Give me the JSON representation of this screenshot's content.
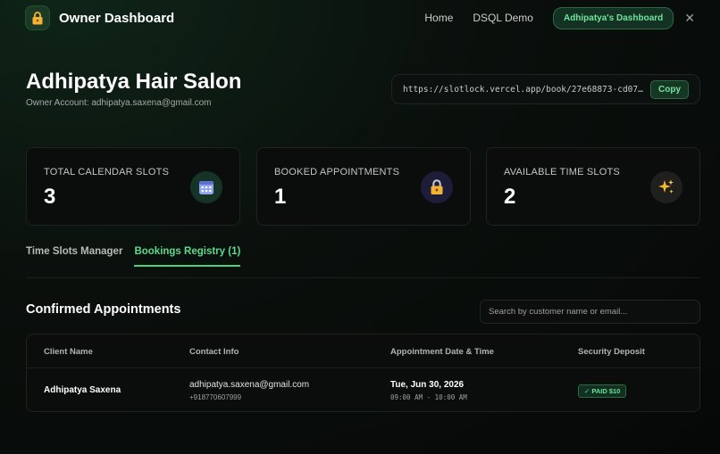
{
  "header": {
    "brand": "Owner Dashboard",
    "nav": [
      "Home",
      "DSQL Demo"
    ],
    "dashboard_button": "Adhipatya's Dashboard",
    "close_glyph": "✕"
  },
  "page": {
    "title": "Adhipatya Hair Salon",
    "subtitle": "Owner Account: adhipatya.saxena@gmail.com"
  },
  "booking_link": {
    "url": "https://slotlock.vercel.app/book/27e68873-cd07-…",
    "copy_label": "Copy"
  },
  "stats": [
    {
      "label": "TOTAL CALENDAR SLOTS",
      "value": "3",
      "icon": "calendar-icon"
    },
    {
      "label": "BOOKED APPOINTMENTS",
      "value": "1",
      "icon": "lock-icon"
    },
    {
      "label": "AVAILABLE TIME SLOTS",
      "value": "2",
      "icon": "sparkles-icon"
    }
  ],
  "tabs": [
    {
      "label": "Time Slots Manager"
    },
    {
      "label": "Bookings Registry (1)"
    }
  ],
  "section": {
    "title": "Confirmed Appointments",
    "search_placeholder": "Search by customer name or email..."
  },
  "table": {
    "headers": [
      "Client Name",
      "Contact Info",
      "Appointment Date & Time",
      "Security Deposit"
    ],
    "rows": [
      {
        "name": "Adhipatya Saxena",
        "email": "adhipatya.saxena@gmail.com",
        "phone": "+918770607999",
        "date": "Tue, Jun 30, 2026",
        "time": "09:00 AM - 10:00 AM",
        "deposit": "✓ PAID $10"
      }
    ]
  },
  "colors": {
    "accent": "#4fd07f",
    "background": "#0a0f0c",
    "card": "#0b0d0c"
  }
}
